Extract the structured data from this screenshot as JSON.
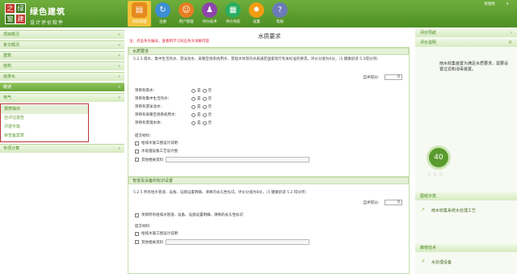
{
  "header": {
    "logo_chars": [
      "之",
      "绿",
      "窗",
      "建"
    ],
    "brand_title": "绿色建筑",
    "brand_subtitle": "设计评价软件",
    "nav": [
      {
        "label": "项目管理",
        "icon": "folder-icon",
        "color": "#f4c13a"
      },
      {
        "label": "注册",
        "icon": "refresh-icon",
        "color": "#3b8fd4"
      },
      {
        "label": "用户管理",
        "icon": "users-icon",
        "color": "#e67e22"
      },
      {
        "label": "评价技术",
        "icon": "people-icon",
        "color": "#8e44ad"
      },
      {
        "label": "评价导航",
        "icon": "nav-icon",
        "color": "#27ae60"
      },
      {
        "label": "设置",
        "icon": "gear-icon",
        "color": "#f39c12"
      },
      {
        "label": "帮助",
        "icon": "help-icon",
        "color": "#6c7bb8"
      }
    ],
    "user": "哈哈哈",
    "close": "✕"
  },
  "sidebar": {
    "items": [
      {
        "label": "项目概况"
      },
      {
        "label": "条文概况"
      },
      {
        "label": "建筑"
      },
      {
        "label": "结构"
      },
      {
        "label": "给排水"
      },
      {
        "label": "暖通"
      },
      {
        "label": "电气"
      }
    ],
    "sub_items": [
      "报表输出",
      "自评估报告",
      "评建专篇",
      "审查备案表"
    ],
    "bottom": "专项计算"
  },
  "main": {
    "title": "水质要求",
    "hint": "注：点击条文编号，查看和学习对应条文详解内容",
    "sec1": {
      "header": "水质要求",
      "para": "5.2.3 雨水、集中生活热水、游泳池水、采暖空调系统用水、景观水体等的水质满足国家现行有关标准的要求。评价分值为6分。（5 健康舒适 5.3得分项）",
      "score_label": "自评得分：",
      "score_value": "0",
      "questions": [
        "项目有雨水：",
        "项目有集中生活热水：",
        "项目有游泳池水：",
        "项目有采暖空调系统用水：",
        "项目有景观水体："
      ],
      "yes": "是",
      "no": "否",
      "materials_label": "提交材料：",
      "materials": [
        "给排水施工图设计说明",
        "水处理设备工艺设计图",
        "其他相关资料"
      ]
    },
    "sec2": {
      "header": "管道及设备的标识设置",
      "para": "5.2.5 所有给水管道、设备、设施设置明确、清晰的永久性标识。评价分值为8分。（5 健康舒适 5.2 得分项）",
      "score_label": "自评得分：",
      "score_value": "0",
      "check": "项目所有给排水管道、设备、设施设置明确、清晰的永久性标识",
      "materials_label": "提交材料：",
      "materials": [
        "给排水施工图设计说明",
        "其他相关资料"
      ]
    }
  },
  "right": {
    "header": "评价导航",
    "sub_header": "评价说明",
    "close": "✕",
    "desc": "雨水收集装置为满足水质要求，需要设置过滤和消毒装置。",
    "score": "40",
    "stars": "☆☆☆",
    "diagram_header": "图纸示意",
    "diagram_link": "雨水收集系统水处理工艺",
    "tech_header": "推荐技术",
    "tech_link": "水处理设备"
  }
}
